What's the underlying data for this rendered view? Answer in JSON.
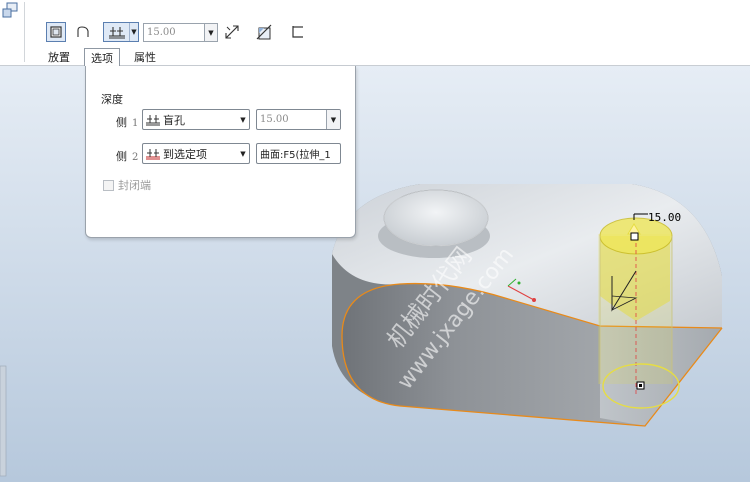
{
  "toolbar": {
    "depth_value": "15.00",
    "icons": [
      "feature-icon",
      "solid-icon",
      "surface-icon",
      "blind-hole-icon",
      "flip-direction-icon",
      "remove-material-icon",
      "thicken-icon"
    ]
  },
  "tabs": [
    {
      "label": "放置",
      "active": false
    },
    {
      "label": "选项",
      "active": true
    },
    {
      "label": "属性",
      "active": false
    }
  ],
  "options_panel": {
    "title": "深度",
    "side1": {
      "label": "侧",
      "num": "1",
      "type": "盲孔",
      "value": "15.00"
    },
    "side2": {
      "label": "侧",
      "num": "2",
      "type": "到选定项",
      "reference": "曲面:F5(拉伸_1"
    },
    "capped_ends": {
      "label": "封闭端",
      "checked": false,
      "enabled": false
    }
  },
  "model": {
    "dimension": "15.00",
    "watermark_line1": "机械时代网",
    "watermark_line2": "www.jxage.com"
  },
  "colors": {
    "accent": "#5b7fb0",
    "viewport_top": "#e3ebf3",
    "viewport_bottom": "#b8cadd",
    "selection": "#e88a1a",
    "preview": "#e6dd44"
  }
}
